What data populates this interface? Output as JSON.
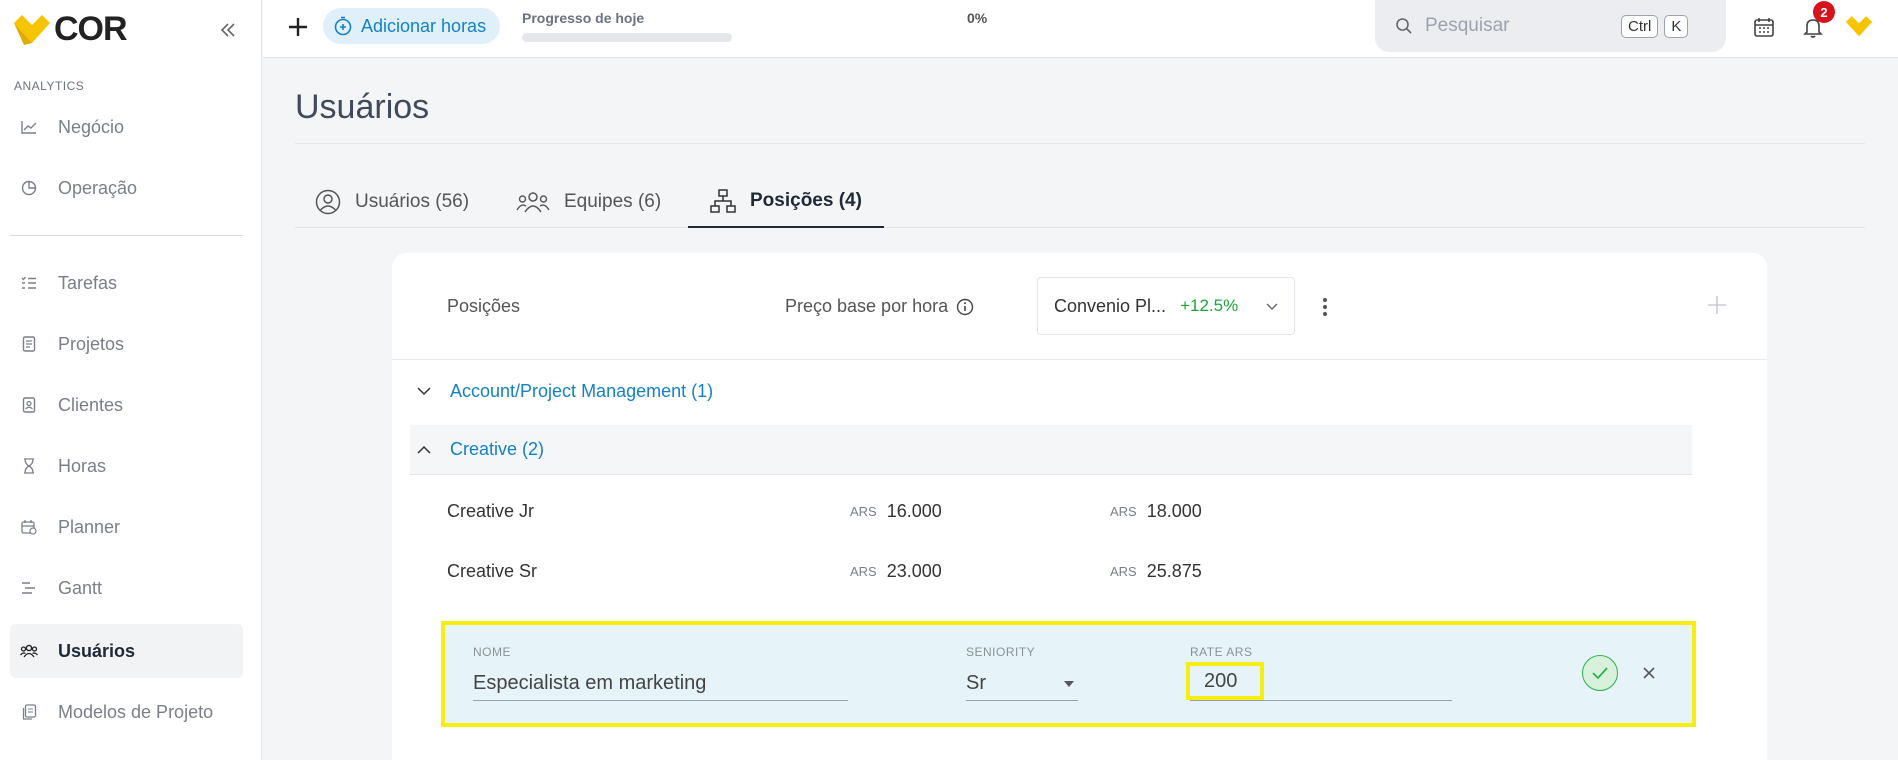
{
  "app": {
    "logo_text": "COR"
  },
  "sidebar": {
    "section_label": "ANALYTICS",
    "items": [
      {
        "label": "Negócio"
      },
      {
        "label": "Operação"
      },
      {
        "label": "Tarefas"
      },
      {
        "label": "Projetos"
      },
      {
        "label": "Clientes"
      },
      {
        "label": "Horas"
      },
      {
        "label": "Planner"
      },
      {
        "label": "Gantt"
      },
      {
        "label": "Usuários"
      },
      {
        "label": "Modelos de Projeto"
      }
    ]
  },
  "topbar": {
    "add_hours_label": "Adicionar horas",
    "progress_label": "Progresso de hoje",
    "progress_pct": "0%",
    "progress_value": 0,
    "search_placeholder": "Pesquisar",
    "kbd_ctrl": "Ctrl",
    "kbd_k": "K",
    "notifications_count": "2"
  },
  "page": {
    "title": "Usuários",
    "tabs": [
      {
        "label": "Usuários (56)"
      },
      {
        "label": "Equipes (6)"
      },
      {
        "label": "Posições (4)"
      }
    ]
  },
  "positions": {
    "header_positions": "Posições",
    "header_price": "Preço base por hora",
    "convenio_name": "Convenio Pl...",
    "convenio_pct": "+12.5%",
    "groups": [
      {
        "label": "Account/Project Management (1)"
      },
      {
        "label": "Creative (2)"
      }
    ],
    "rows": [
      {
        "name": "Creative Jr",
        "cur1": "ARS",
        "val1": "16.000",
        "cur2": "ARS",
        "val2": "18.000"
      },
      {
        "name": "Creative Sr",
        "cur1": "ARS",
        "val1": "23.000",
        "cur2": "ARS",
        "val2": "25.875"
      }
    ],
    "edit": {
      "name_label": "NOME",
      "name_value": "Especialista em marketing",
      "seniority_label": "SENIORITY",
      "seniority_value": "Sr",
      "rate_label": "RATE ARS",
      "rate_value": "200"
    }
  },
  "colors": {
    "accent": "#1480c8",
    "logo_yellow": "#f6c400",
    "highlight": "#f6ee12",
    "success": "#22a33a"
  }
}
